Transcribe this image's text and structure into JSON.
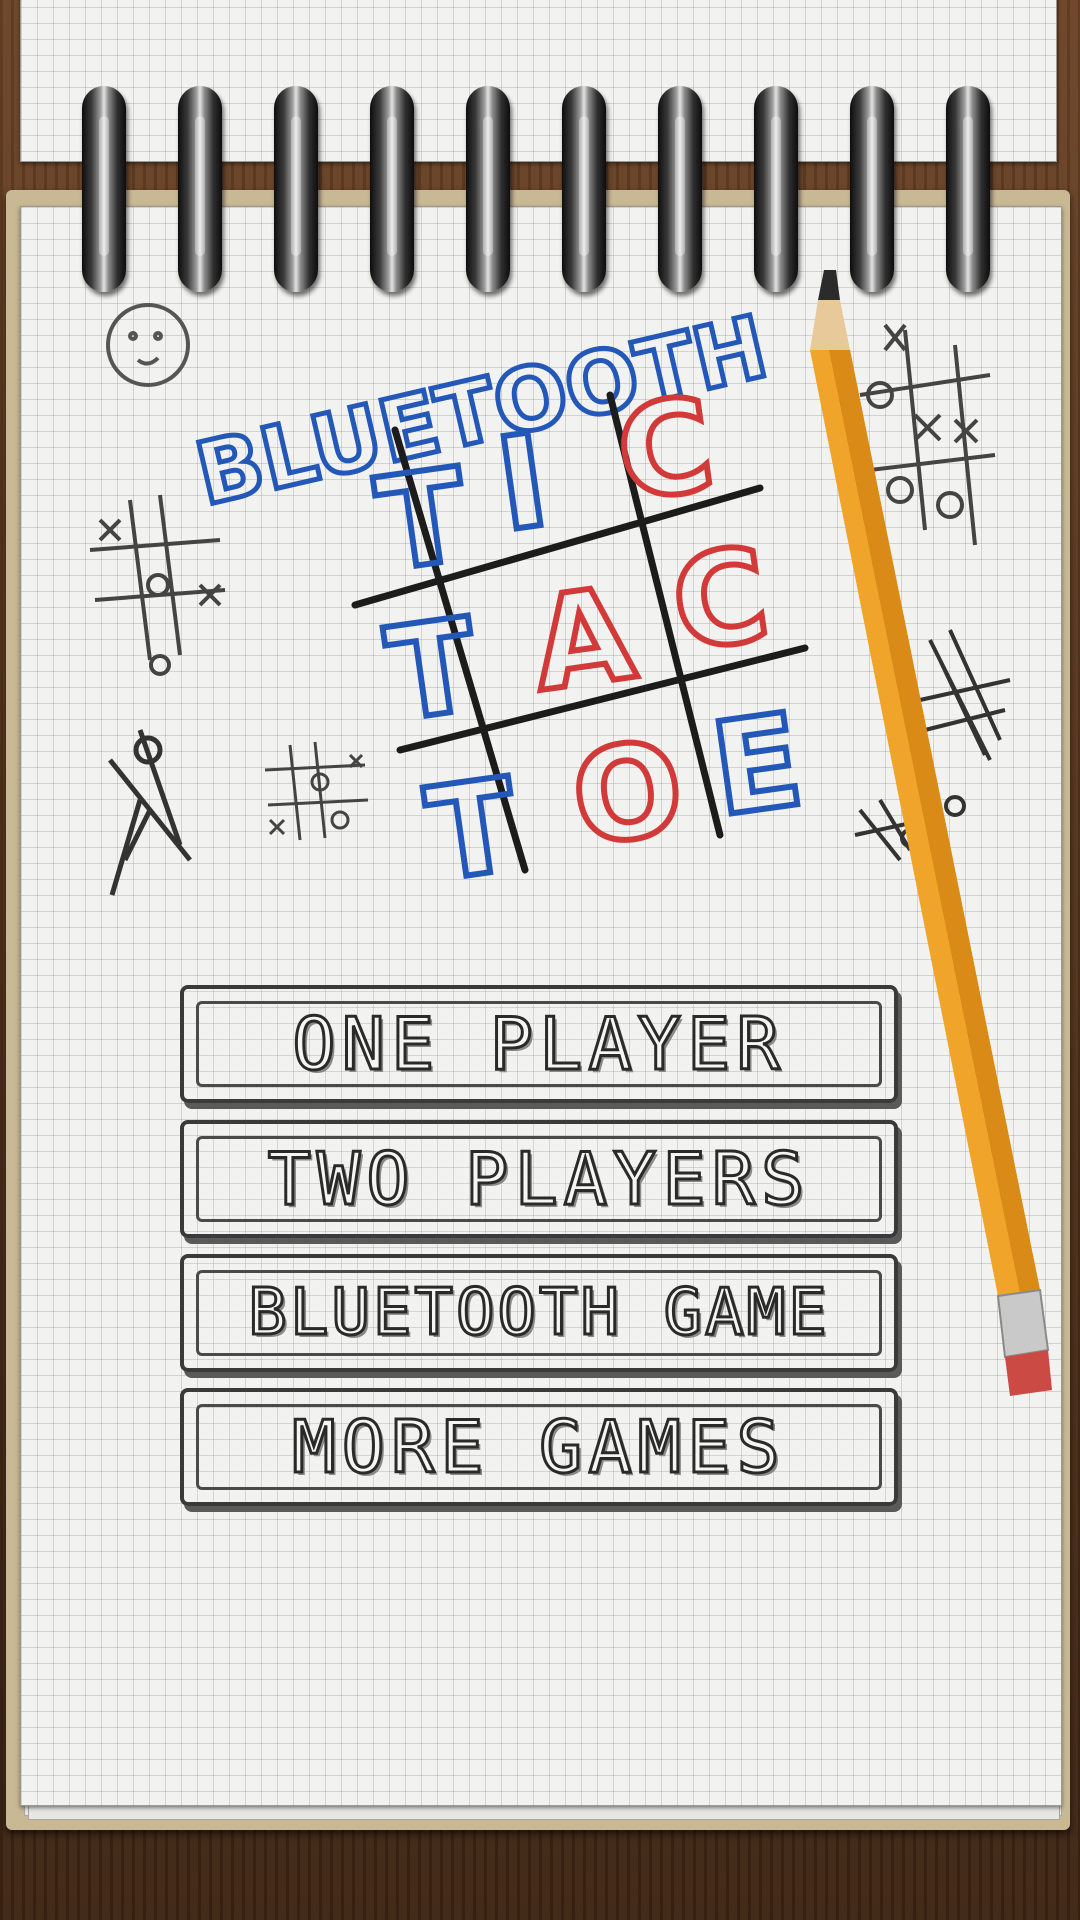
{
  "title": {
    "top_word": "BLUETOOTH",
    "grid_letters": [
      {
        "text": "T",
        "color": "blue"
      },
      {
        "text": "I",
        "color": "blue"
      },
      {
        "text": "C",
        "color": "red"
      },
      {
        "text": "T",
        "color": "blue"
      },
      {
        "text": "A",
        "color": "red"
      },
      {
        "text": "C",
        "color": "red"
      },
      {
        "text": "T",
        "color": "blue"
      },
      {
        "text": "O",
        "color": "red"
      },
      {
        "text": "E",
        "color": "blue"
      }
    ]
  },
  "menu": {
    "one_player": "ONE PLAYER",
    "two_players": "TWO PLAYERS",
    "bluetooth_game": "BLUETOOTH GAME",
    "more_games": "MORE GAMES"
  },
  "colors": {
    "blue": "#2458b8",
    "red": "#d23a3a",
    "pencil": "#f0a52a",
    "ink": "#2a2a2a"
  }
}
